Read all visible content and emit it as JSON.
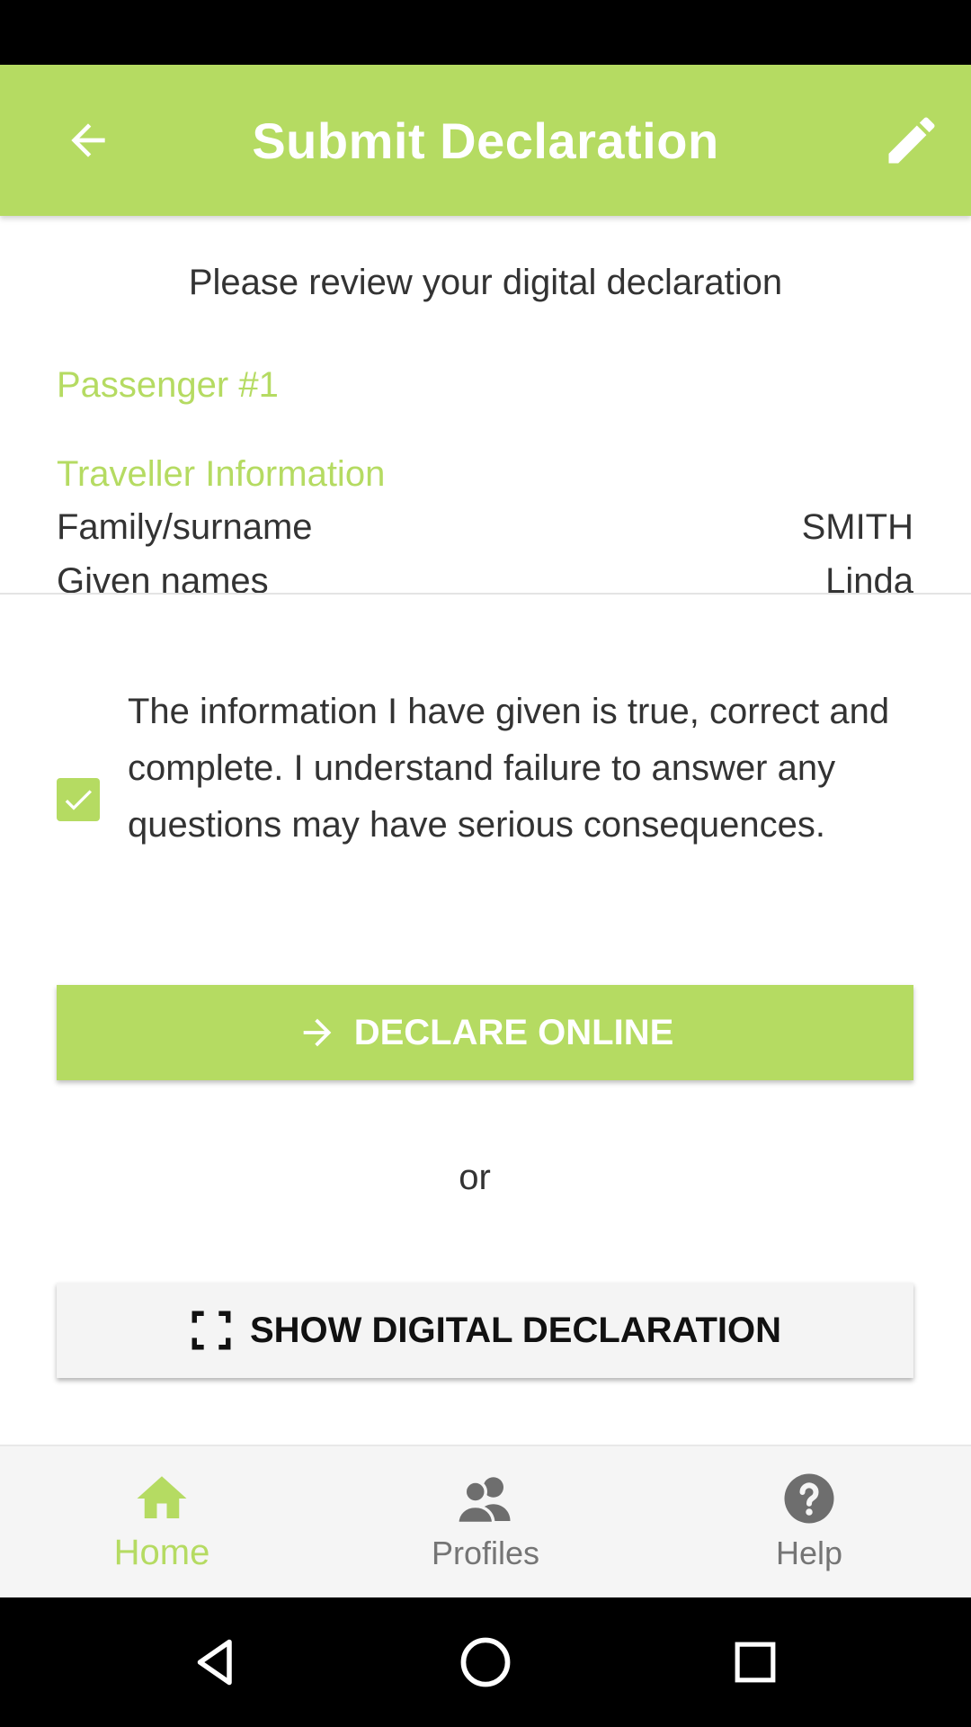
{
  "app_bar": {
    "title": "Submit Declaration",
    "back_icon": "arrow-left-icon",
    "edit_icon": "pencil-icon"
  },
  "review": {
    "intro": "Please review your digital declaration",
    "passenger_title": "Passenger #1",
    "section_title": "Traveller Information",
    "rows": [
      {
        "label": "Family/surname",
        "value": "SMITH"
      },
      {
        "label": "Given names",
        "value": "Linda"
      }
    ]
  },
  "consent": {
    "checked": true,
    "text": "The information I have given is true, correct and complete. I understand failure to answer any questions may have serious consequences."
  },
  "actions": {
    "declare_label": "DECLARE ONLINE",
    "or_label": "or",
    "show_label": "SHOW DIGITAL DECLARATION"
  },
  "bottom_nav": {
    "items": [
      {
        "label": "Home",
        "icon": "home-icon",
        "active": true
      },
      {
        "label": "Profiles",
        "icon": "profiles-icon",
        "active": false
      },
      {
        "label": "Help",
        "icon": "help-icon",
        "active": false
      }
    ]
  },
  "system_nav": {
    "icons": [
      "back-triangle-icon",
      "home-circle-icon",
      "recents-square-icon"
    ]
  },
  "colors": {
    "accent": "#b5db62",
    "status_bar": "#000000",
    "text": "#333333",
    "inactive": "#757575"
  }
}
